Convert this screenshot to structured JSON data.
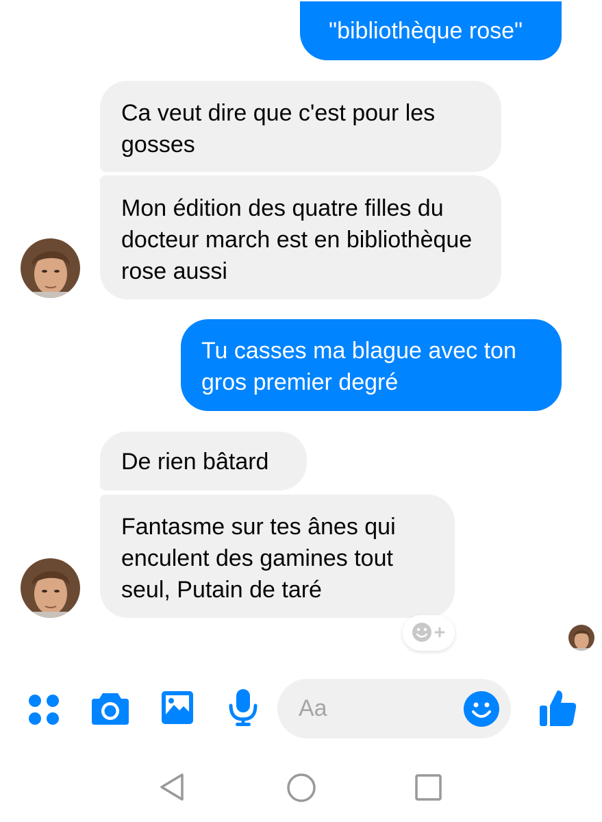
{
  "messages": [
    {
      "side": "out",
      "text": "\"bibliothèque rose\""
    },
    {
      "side": "in",
      "text": "Ca veut dire que c'est pour les gosses"
    },
    {
      "side": "in",
      "text": "Mon édition des quatre filles du docteur march est en bibliothèque rose aussi"
    },
    {
      "side": "out",
      "text": "Tu casses ma blague avec ton gros premier degré"
    },
    {
      "side": "in",
      "text": "De rien bâtard"
    },
    {
      "side": "in",
      "text": "Fantasme sur tes ânes qui enculent des gamines tout seul, Putain de taré"
    }
  ],
  "composer": {
    "placeholder": "Aa",
    "icons": [
      "more-apps-icon",
      "camera-icon",
      "gallery-icon",
      "microphone-icon",
      "emoji-icon",
      "thumbs-up-icon"
    ]
  },
  "nav": {
    "icons": [
      "back-icon",
      "home-icon",
      "recents-icon"
    ]
  },
  "colors": {
    "accent": "#0084ff",
    "incoming_bubble": "#f1f0f0",
    "outgoing_text": "#ffffff",
    "nav_icon": "#999999"
  }
}
